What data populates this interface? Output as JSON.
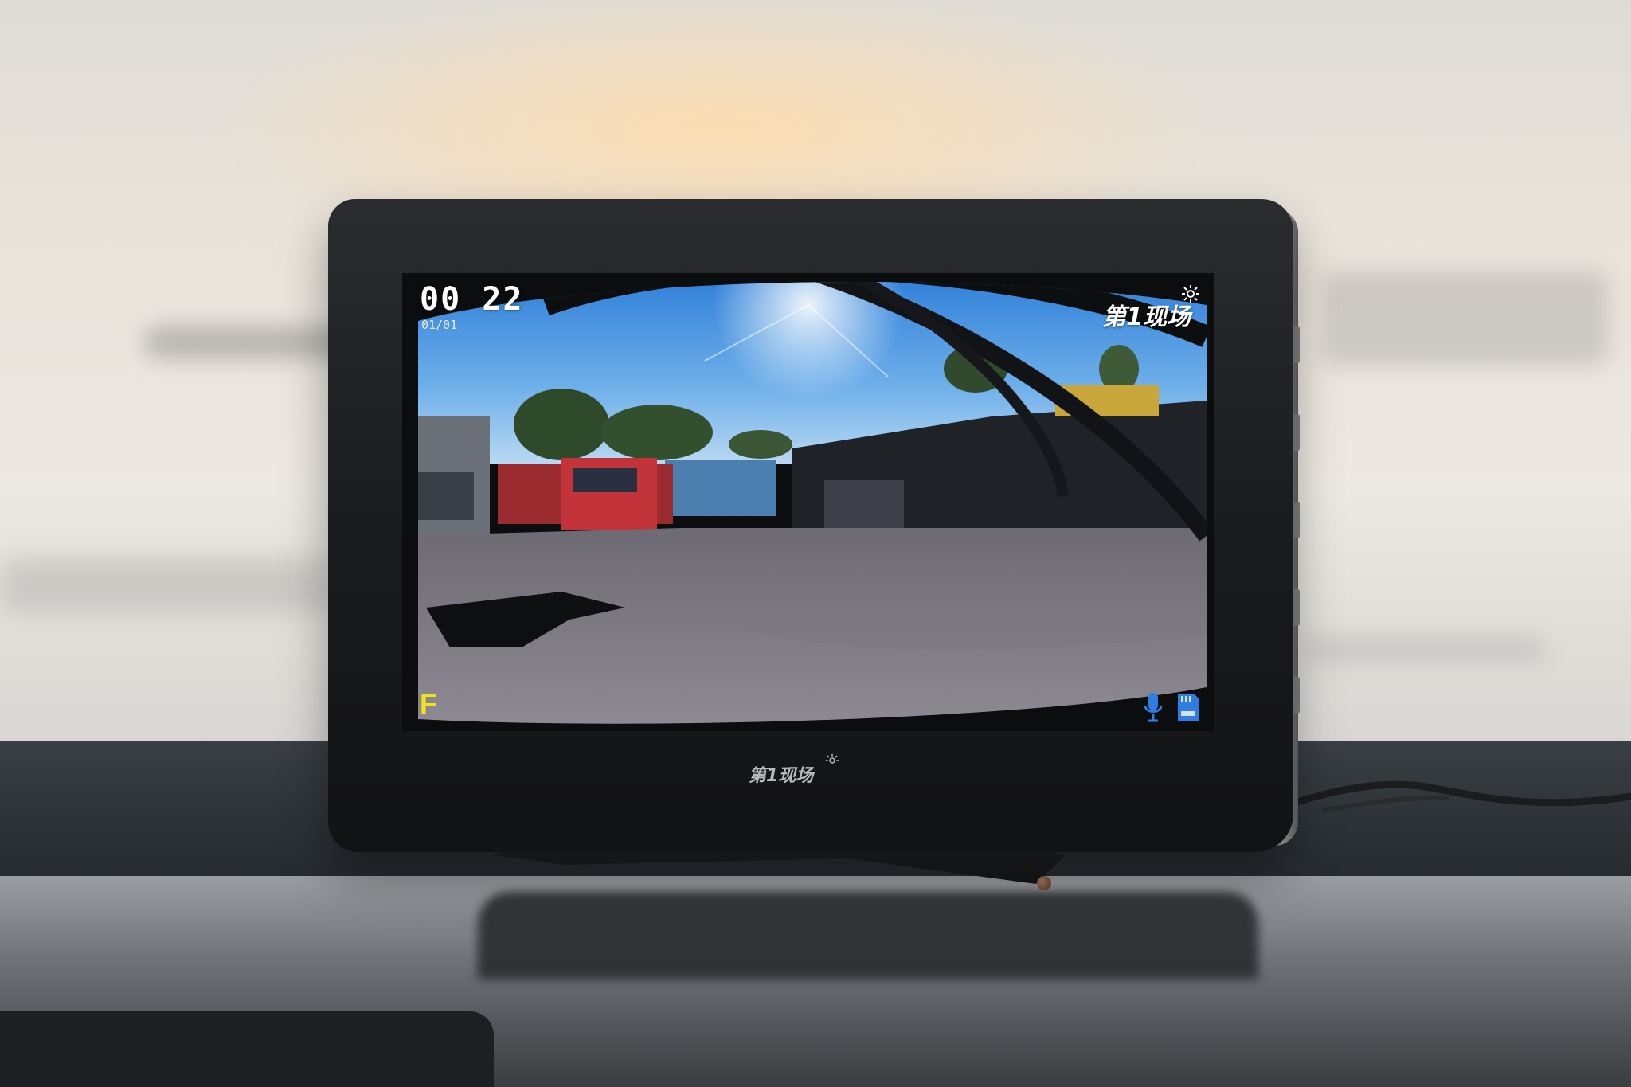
{
  "osd": {
    "time_hours": "00",
    "time_minutes": "22",
    "date": "01/01",
    "brand": "第1现场",
    "camera_indicator": "F",
    "mic_icon": "microphone-icon",
    "storage_icon": "sd-card-icon"
  },
  "bezel": {
    "brand": "第1现场"
  },
  "colors": {
    "osd_text": "#ffffff",
    "osd_indicator": "#f3e21a",
    "osd_icon_blue": "#2f7de0",
    "housing": "#1a1b1d"
  }
}
